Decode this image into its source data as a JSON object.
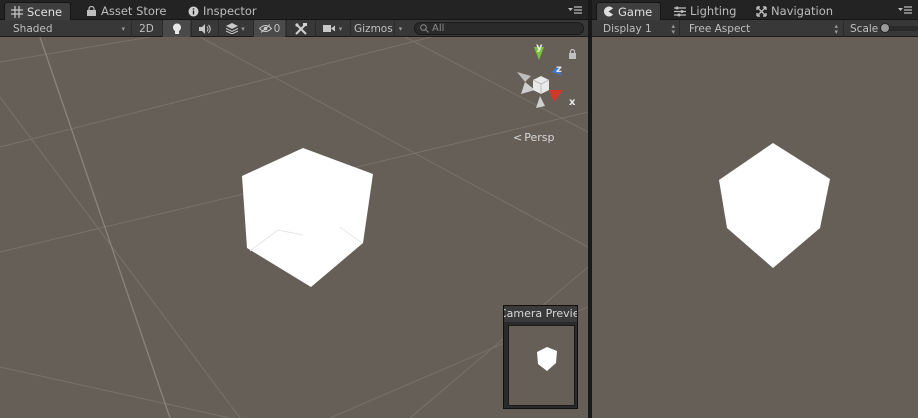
{
  "scene_panel": {
    "tabs": [
      {
        "label": "Scene",
        "icon": "grid-icon",
        "active": true
      },
      {
        "label": "Asset Store",
        "icon": "bag-icon",
        "active": false
      },
      {
        "label": "Inspector",
        "icon": "info-icon",
        "active": false
      }
    ],
    "toolbar": {
      "shading_mode": "Shaded",
      "mode_2d": "2D",
      "hidden_count": "0",
      "gizmos_label": "Gizmos",
      "search_placeholder": "All"
    },
    "orientation_gizmo": {
      "y": "y",
      "z": "z",
      "x": "x",
      "projection": "Persp"
    },
    "camera_preview": {
      "title": "Camera Preview"
    }
  },
  "game_panel": {
    "tabs": [
      {
        "label": "Game",
        "icon": "pacman-icon",
        "active": true
      },
      {
        "label": "Lighting",
        "icon": "lighting-icon",
        "active": false
      },
      {
        "label": "Navigation",
        "icon": "navigation-icon",
        "active": false
      }
    ],
    "toolbar": {
      "display": "Display 1",
      "aspect": "Free Aspect",
      "scale_label": "Scale"
    }
  },
  "colors": {
    "viewport_bg": "#665f58",
    "toolbar_bg": "#383838",
    "tab_active": "#3e3e3e",
    "axis_x": "#d03828",
    "axis_y": "#7ac23c",
    "axis_z": "#3a7ae0"
  }
}
